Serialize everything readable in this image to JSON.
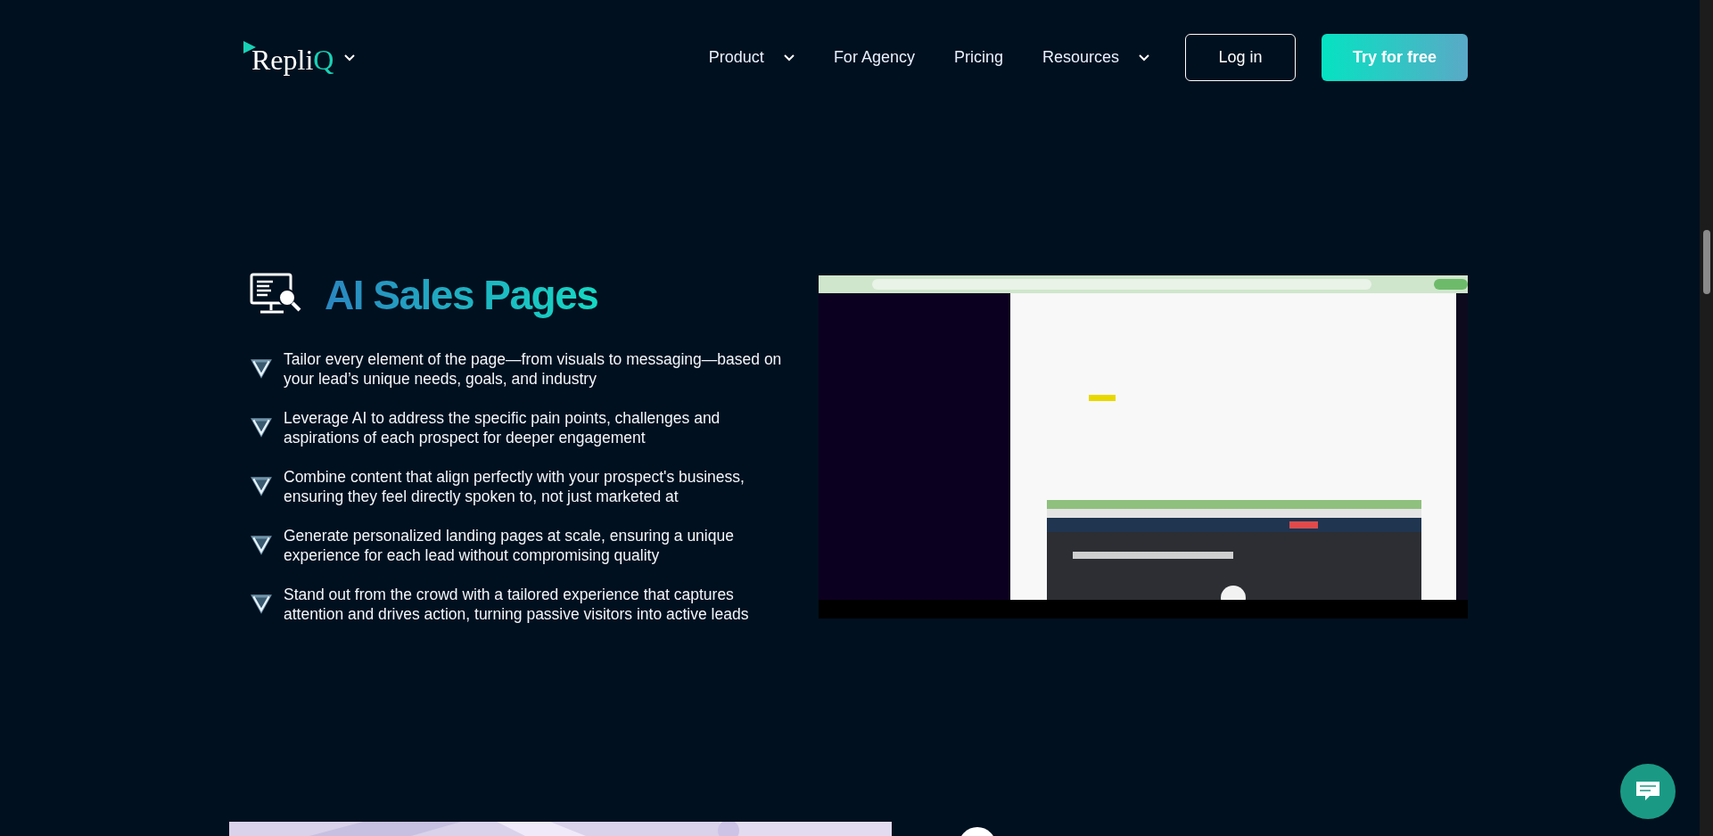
{
  "header": {
    "logo": {
      "text": "Repli",
      "accent": "Q"
    },
    "nav": [
      {
        "label": "Product",
        "has_menu": true
      },
      {
        "label": "For Agency",
        "has_menu": false
      },
      {
        "label": "Pricing",
        "has_menu": false
      },
      {
        "label": "Resources",
        "has_menu": true
      }
    ],
    "login": "Log in",
    "cta": "Try for free"
  },
  "feature": {
    "title": "AI Sales Pages",
    "bullets": [
      "Tailor every element of the page—from visuals to messaging—based on your lead’s unique needs, goals, and industry",
      "Leverage AI to address the specific pain points, challenges and aspirations of each prospect for deeper engagement",
      "Combine content that align perfectly with your prospect's business, ensuring they feel directly spoken to, not just marketed at",
      "Generate personalized landing pages at scale, ensuring a unique experience for each lead without compromising quality",
      "Stand out from the crowd with a tailored experience that captures attention and drives action, turning passive visitors into active leads"
    ]
  }
}
